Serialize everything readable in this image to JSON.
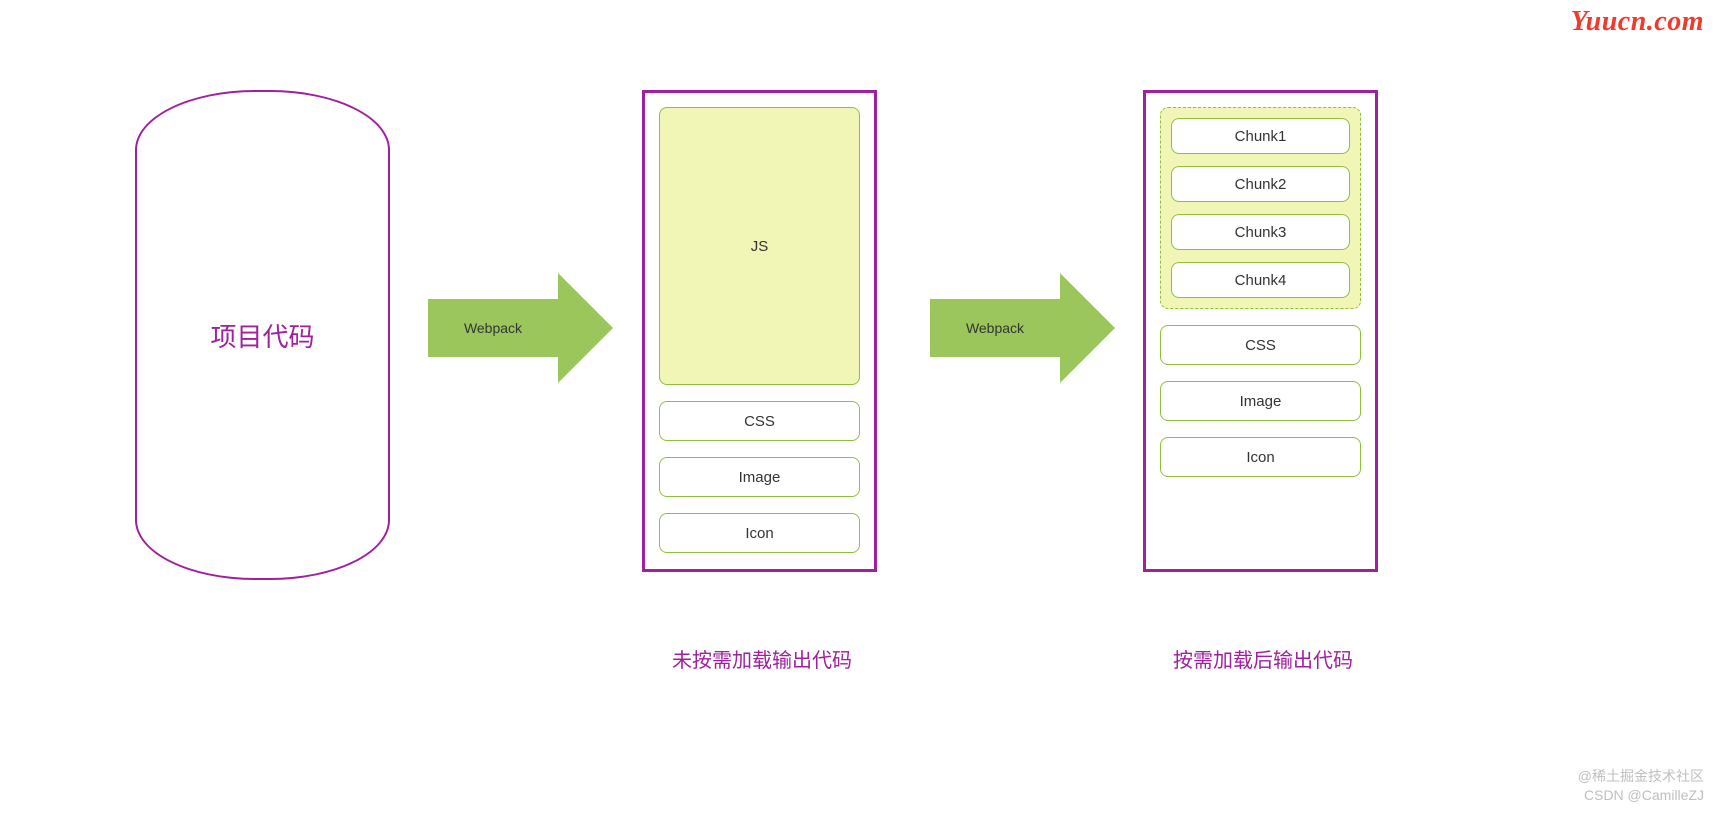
{
  "project": {
    "label": "项目代码"
  },
  "arrows": {
    "label": "Webpack"
  },
  "box1": {
    "js": "JS",
    "css": "CSS",
    "image": "Image",
    "icon": "Icon",
    "caption": "未按需加载输出代码"
  },
  "box2": {
    "chunks": [
      "Chunk1",
      "Chunk2",
      "Chunk3",
      "Chunk4"
    ],
    "css": "CSS",
    "image": "Image",
    "icon": "Icon",
    "caption": "按需加载后输出代码"
  },
  "watermark": {
    "top": "Yuucn.com",
    "bottom_line1": "@稀土掘金技术社区",
    "bottom_line2": "CSDN @CamilleZJ"
  }
}
